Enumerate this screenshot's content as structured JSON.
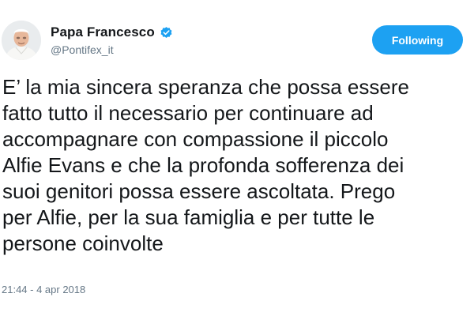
{
  "author": {
    "display_name": "Papa Francesco",
    "handle": "@Pontifex_it",
    "verified": true,
    "avatar_icon": "pope-portrait-avatar",
    "verified_icon": "verified-badge-icon"
  },
  "follow_button": {
    "label": "Following",
    "color": "#1da1f2"
  },
  "tweet": {
    "lines": [
      "E’ la mia sincera speranza che possa essere",
      "fatto tutto il necessario per continuare ad",
      "accompagnare con compassione il piccolo",
      "Alfie Evans e che la profonda sofferenza dei",
      "suoi genitori possa essere ascoltata. Prego",
      "per Alfie, per la sua famiglia e per tutte le",
      "persone coinvolte"
    ],
    "timestamp": "21:44 - 4 apr 2018"
  },
  "colors": {
    "accent": "#1da1f2",
    "text": "#14171a",
    "secondary_text": "#657786"
  }
}
